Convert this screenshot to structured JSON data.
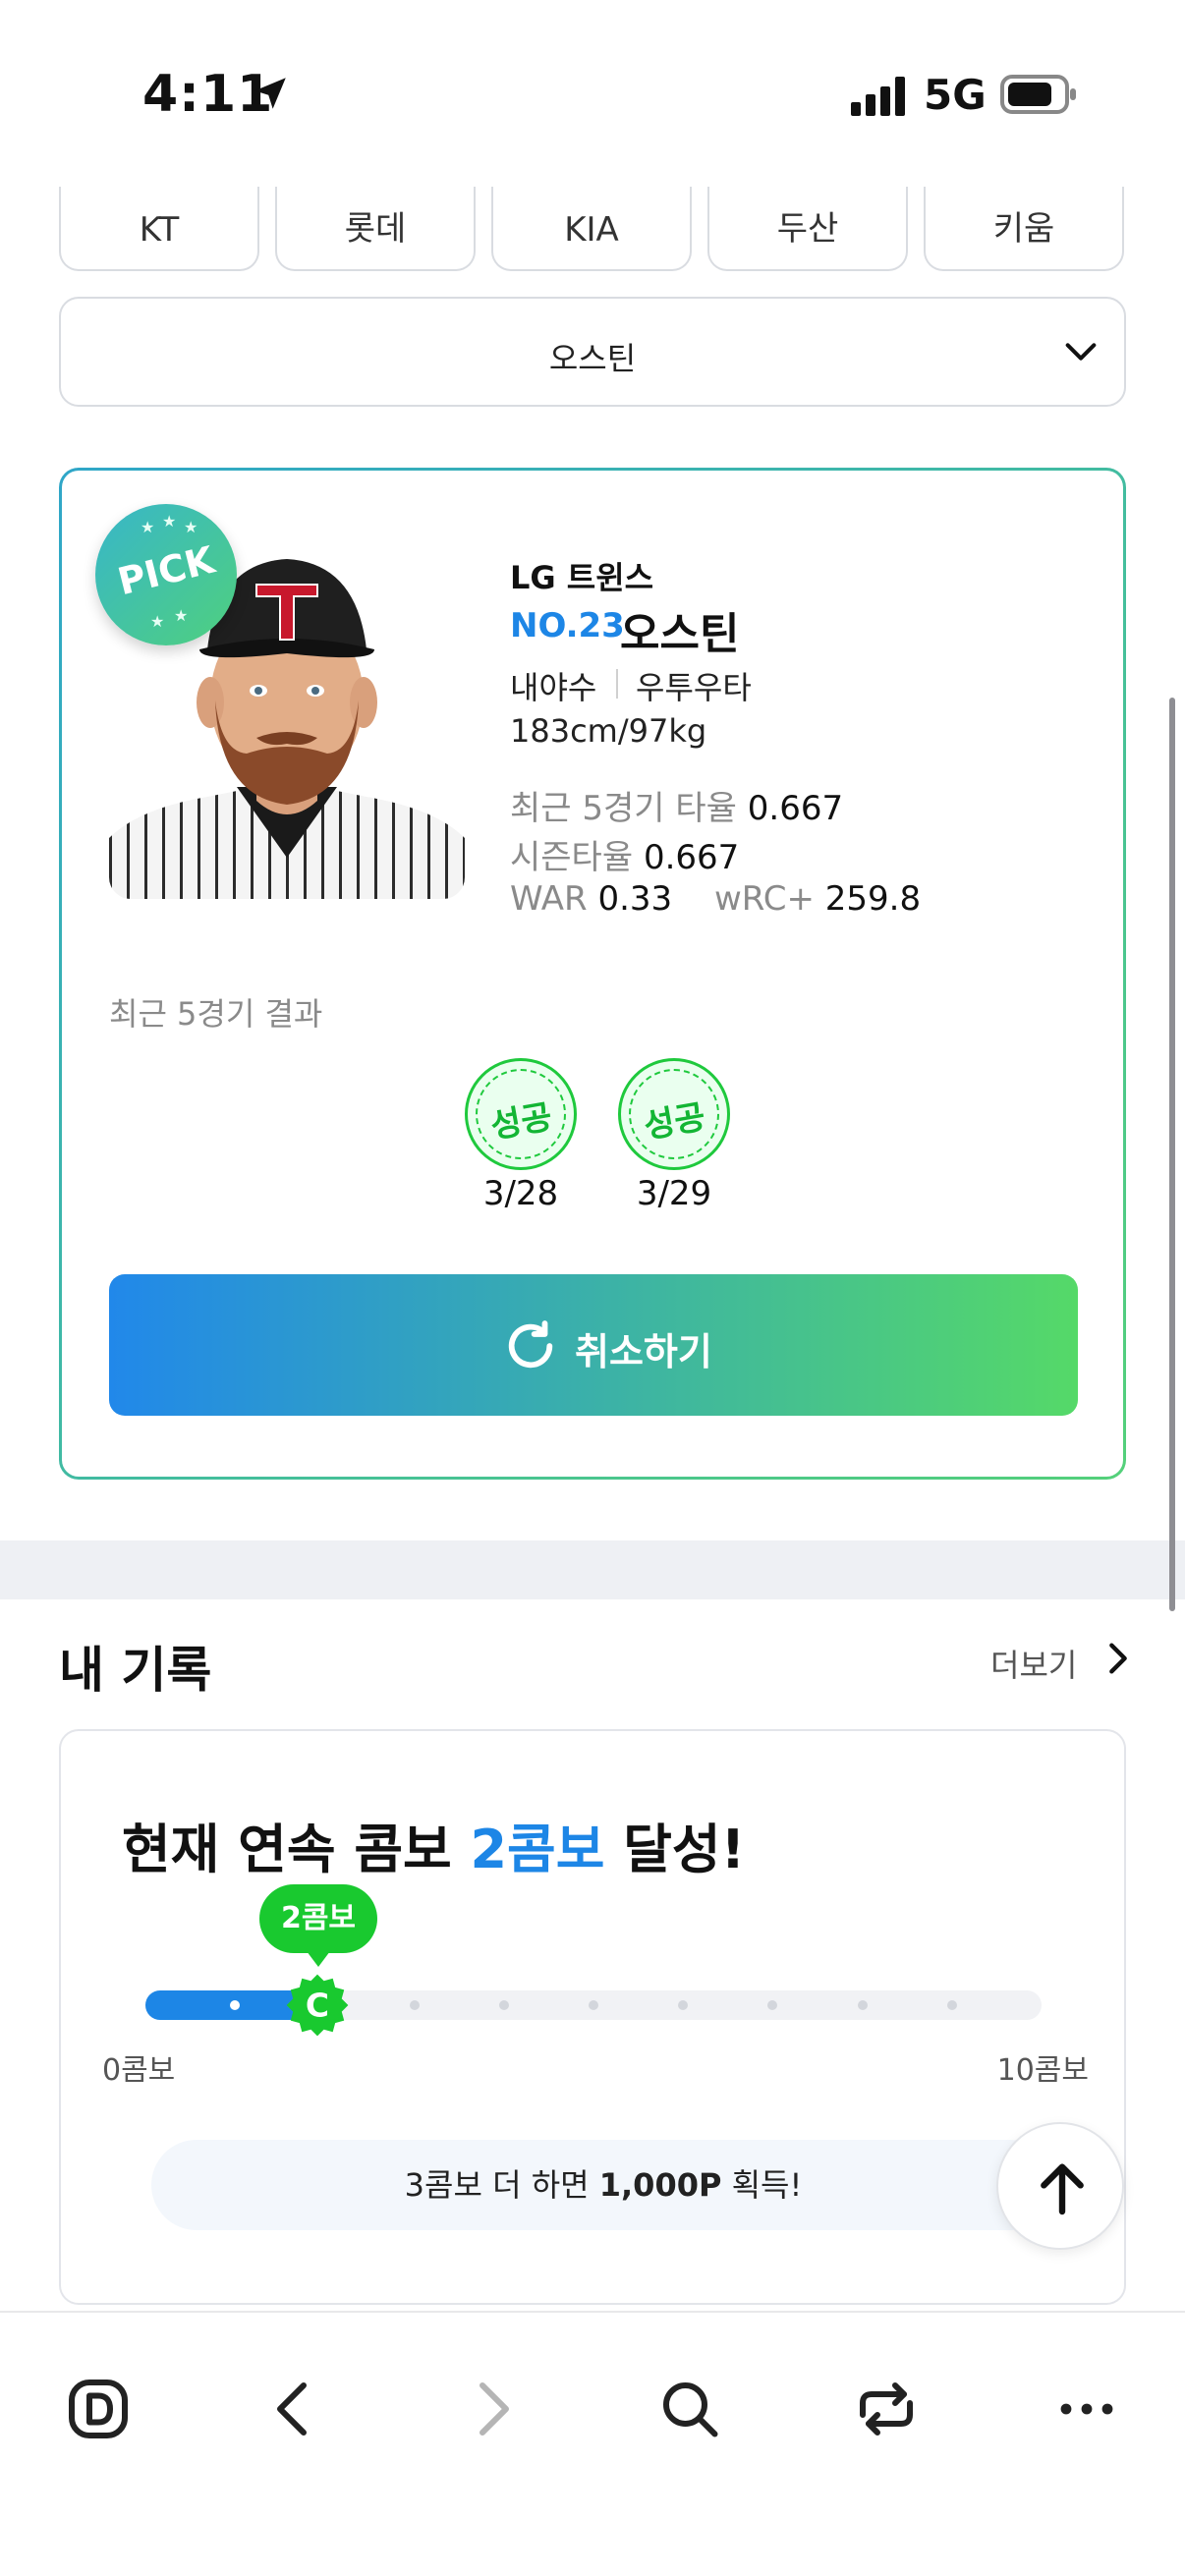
{
  "status_bar": {
    "time": "4:11",
    "network": "5G"
  },
  "teams": [
    "KT",
    "롯데",
    "KIA",
    "두산",
    "키움"
  ],
  "player_select": {
    "selected": "오스틴"
  },
  "pick_card": {
    "badge": "PICK",
    "team": "LG 트윈스",
    "number": "NO.23",
    "name": "오스틴",
    "position": "내야수",
    "hand": "우투우타",
    "body": "183cm/97kg",
    "stats": {
      "recent5_label": "최근 5경기 타율",
      "recent5_value": "0.667",
      "season_label": "시즌타율",
      "season_value": "0.667",
      "war_label": "WAR",
      "war_value": "0.33",
      "wrc_label": "wRC+",
      "wrc_value": "259.8"
    },
    "recent_results_title": "최근 5경기 결과",
    "results": [
      {
        "label": "성공",
        "date": "3/28"
      },
      {
        "label": "성공",
        "date": "3/29"
      }
    ],
    "cancel_label": "취소하기"
  },
  "records": {
    "title": "내 기록",
    "more_label": "더보기",
    "combo": {
      "prefix": "현재 연속 콤보 ",
      "highlight": "2콤보",
      "suffix": " 달성!",
      "bubble": "2콤보",
      "current": 2,
      "max": 10,
      "min_label": "0콤보",
      "max_label": "10콤보",
      "reward_prefix": "3콤보 더 하면 ",
      "reward_bold": "1,000P",
      "reward_suffix": " 획득!"
    }
  },
  "colors": {
    "accent_blue": "#1d86e6",
    "accent_green": "#19c92f"
  },
  "icons": {
    "toolbar": [
      "app-d-icon",
      "back-icon",
      "forward-icon",
      "search-icon",
      "tabs-icon",
      "more-icon"
    ]
  }
}
